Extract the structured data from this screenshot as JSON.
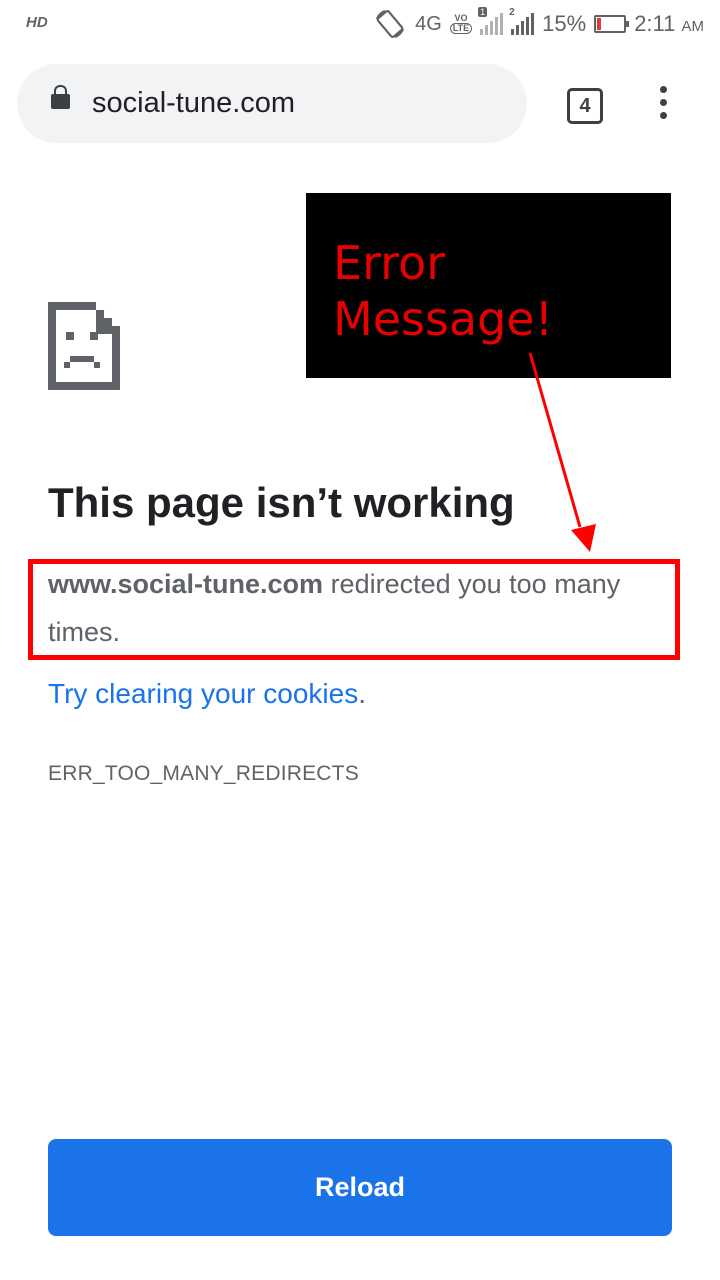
{
  "status_bar": {
    "hd_label": "HD",
    "network": "4G",
    "volte_top": "VO",
    "volte_bottom": "LTE",
    "sim1": "1",
    "sim2": "2",
    "battery_percent": "15%",
    "battery_level": 0.15,
    "time": "2:11",
    "ampm": "AM"
  },
  "toolbar": {
    "url": "social-tune.com",
    "tab_count": "4"
  },
  "annotation": {
    "text": "Error\nMessage!",
    "color": "#e60000"
  },
  "error_page": {
    "title": "This page isn’t working",
    "domain": "www.social-tune.com",
    "message": " redirected you too many times.",
    "link_text": "Try clearing your cookies",
    "link_suffix": ".",
    "error_code": "ERR_TOO_MANY_REDIRECTS",
    "reload_label": "Reload"
  },
  "colors": {
    "accent": "#1a73e8",
    "annotation_border": "#ff0000"
  }
}
